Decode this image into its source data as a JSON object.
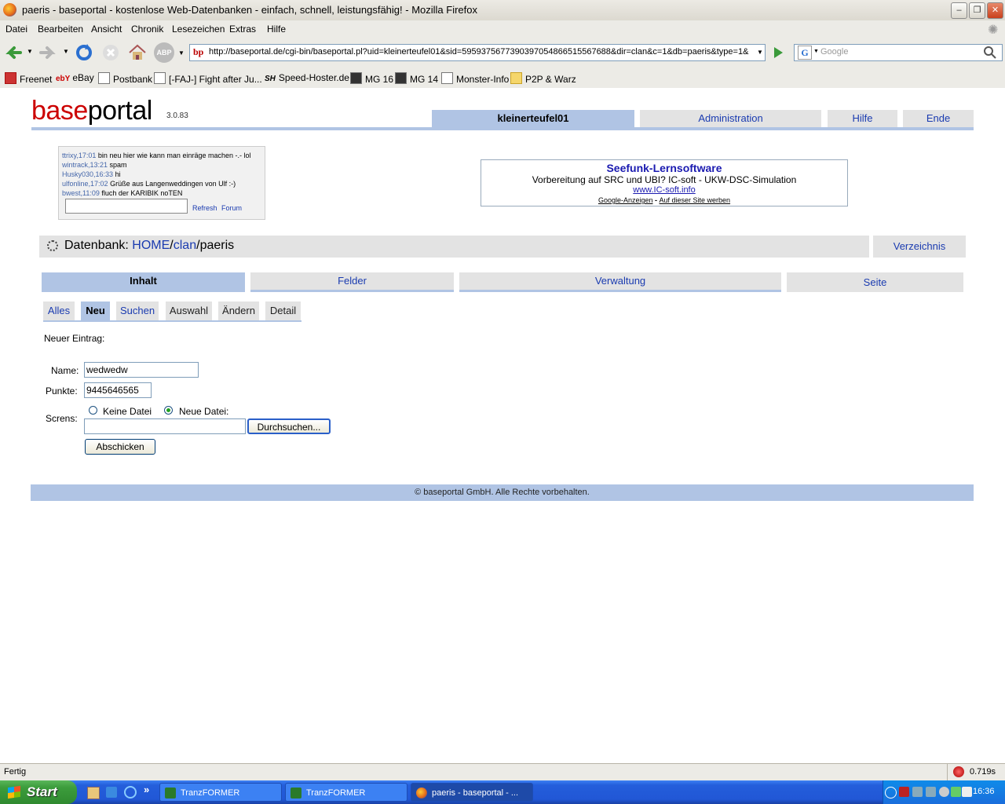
{
  "window": {
    "title": "paeris - baseportal - kostenlose Web-Datenbanken - einfach, schnell, leistungsfähig! - Mozilla Firefox"
  },
  "menu": [
    "Datei",
    "Bearbeiten",
    "Ansicht",
    "Chronik",
    "Lesezeichen",
    "Extras",
    "Hilfe"
  ],
  "toolbar": {
    "url": "http://baseportal.de/cgi-bin/baseportal.pl?uid=kleinerteufel01&sid=5959375677390397054866515567688&dir=clan&c=1&db=paeris&type=1&",
    "search_placeholder": "Google",
    "url_badge": "bp",
    "abp": "ABP"
  },
  "bookmarks": [
    "Freenet",
    "eBay",
    "Postbank",
    "[-FAJ-] Fight after Ju...",
    "Speed-Hoster.de",
    "MG 16",
    "MG 14",
    "Monster-Info",
    "P2P & Warz"
  ],
  "bookmark_badges": {
    "ebay": "ebY",
    "sh": "SH"
  },
  "header": {
    "logo_red": "base",
    "logo_black": "portal",
    "version": "3.0.83",
    "user": "kleinerteufel01",
    "admin": "Administration",
    "help": "Hilfe",
    "end": "Ende"
  },
  "forum": {
    "entries": [
      {
        "nick": "ttrixy,17:01",
        "text": "bin neu hier wie kann man einräge machen -.- lol"
      },
      {
        "nick": "wintrack,13:21",
        "text": "spam"
      },
      {
        "nick": "Husky030,16:33",
        "text": "hi"
      },
      {
        "nick": "ulfonline,17:02",
        "text": "Grüße aus Langenweddingen von Ulf :-)"
      },
      {
        "nick": "bwest,11:09",
        "text": "fluch der KARIBIK noTEN"
      }
    ],
    "refresh": "Refresh",
    "forum": "Forum"
  },
  "ad": {
    "title": "Seefunk-Lernsoftware",
    "desc": "Vorbereitung auf SRC und UBI? IC-soft - UKW-DSC-Simulation",
    "url": "www.IC-soft.info",
    "google": "Google-Anzeigen",
    "sep": " - ",
    "advertise": "Auf dieser Site werben"
  },
  "db": {
    "label": "Datenbank:",
    "home": "HOME",
    "sep": "/",
    "clan": "clan",
    "name": "paeris",
    "directory": "Verzeichnis"
  },
  "tabs": [
    "Inhalt",
    "Felder",
    "Verwaltung",
    "Seite"
  ],
  "subtabs": [
    "Alles",
    "Neu",
    "Suchen",
    "Auswahl",
    "Ändern",
    "Detail"
  ],
  "form": {
    "heading": "Neuer Eintrag:",
    "name_label": "Name:",
    "name_value": "wedwedw",
    "punkte_label": "Punkte:",
    "punkte_value": "9445646565",
    "screns_label": "Screns:",
    "no_file": "Keine Datei",
    "new_file": "Neue Datei:",
    "browse": "Durchsuchen...",
    "submit": "Abschicken"
  },
  "footer": "© baseportal GmbH. Alle Rechte vorbehalten.",
  "status": {
    "text": "Fertig",
    "time": "0.719s"
  },
  "taskbar": {
    "start": "Start",
    "more": "»",
    "tasks": [
      "TranzFORMER",
      "TranzFORMER",
      "paeris - baseportal - ..."
    ],
    "clock": "16:36"
  }
}
